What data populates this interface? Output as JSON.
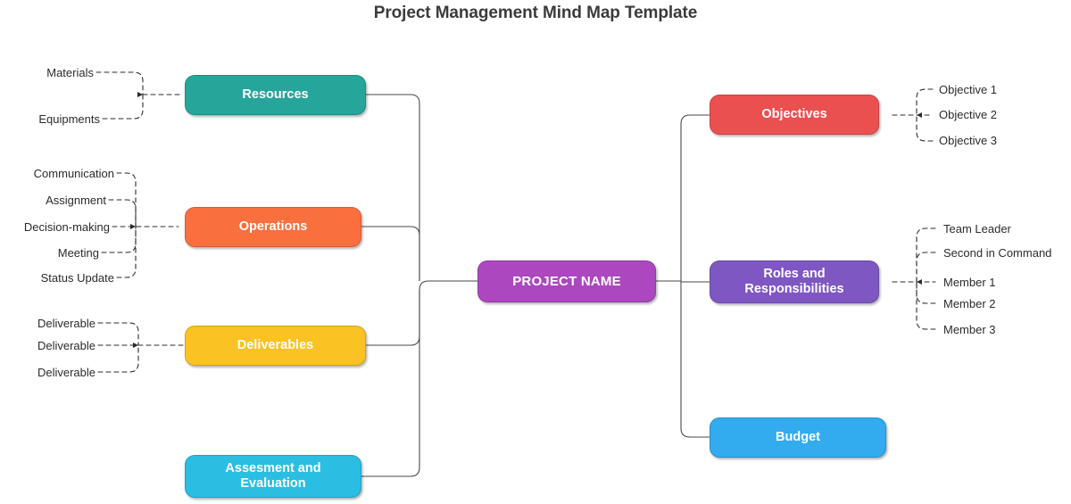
{
  "title": "Project Management Mind Map Template",
  "center": {
    "label": "PROJECT NAME",
    "color": "#AC47BF"
  },
  "colors": {
    "resources": "#26A69A",
    "operations": "#F9703E",
    "deliverables": "#FAC222",
    "assessment": "#2BBEE3",
    "objectives": "#EB5050",
    "roles": "#7E57C2",
    "budget": "#33ABEF",
    "connector": "#4a4a4a",
    "leaf_text": "#2b2b2b",
    "title_text": "#3b3b3b"
  },
  "branches": {
    "left": [
      {
        "id": "resources",
        "label": "Resources",
        "color": "#26A69A",
        "leaves": [
          "Materials",
          "Equipments"
        ]
      },
      {
        "id": "operations",
        "label": "Operations",
        "color": "#F9703E",
        "leaves": [
          "Communication",
          "Assignment",
          "Decision-making",
          "Meeting",
          "Status Update"
        ]
      },
      {
        "id": "deliverables",
        "label": "Deliverables",
        "color": "#FAC222",
        "leaves": [
          "Deliverable",
          "Deliverable",
          "Deliverable"
        ]
      },
      {
        "id": "assessment",
        "label_line1": "Assesment and",
        "label_line2": "Evaluation",
        "color": "#2BBEE3",
        "leaves": []
      }
    ],
    "right": [
      {
        "id": "objectives",
        "label": "Objectives",
        "color": "#EB5050",
        "leaves": [
          "Objective 1",
          "Objective 2",
          "Objective 3"
        ]
      },
      {
        "id": "roles",
        "label_line1": "Roles and",
        "label_line2": "Responsibilities",
        "color": "#7E57C2",
        "leaves": [
          "Team Leader",
          "Second in Command",
          "Member 1",
          "Member 2",
          "Member 3"
        ]
      },
      {
        "id": "budget",
        "label": "Budget",
        "color": "#33ABEF",
        "leaves": []
      }
    ]
  }
}
